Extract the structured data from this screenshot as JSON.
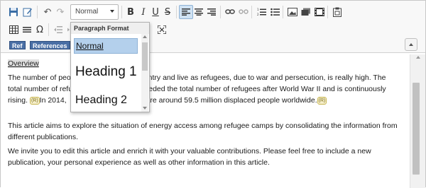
{
  "toolbar": {
    "format_select_value": "Normal",
    "icons": [
      "save-icon",
      "edit-icon",
      "undo-icon",
      "redo-icon",
      "bold-icon",
      "italic-icon",
      "underline-icon",
      "strikethrough-icon",
      "align-left-icon",
      "align-center-icon",
      "align-right-icon",
      "link-icon",
      "unlink-icon",
      "numbered-list-icon",
      "bulleted-list-icon",
      "image-icon",
      "gallery-icon",
      "video-icon",
      "paste-icon",
      "table-icon",
      "horizontal-rule-icon",
      "omega-icon",
      "indent-decrease-icon",
      "indent-increase-icon",
      "fullscreen-icon"
    ],
    "bold_glyph": "B",
    "italic_glyph": "I",
    "underline_glyph": "U",
    "strike_glyph": "S",
    "omega_glyph": "Ω",
    "ref_label": "Ref",
    "references_label": "References"
  },
  "dropdown": {
    "title": "Paragraph Format",
    "items": [
      {
        "label": "Normal",
        "selected": true
      },
      {
        "label": "Heading 1",
        "selected": false
      },
      {
        "label": "Heading 2",
        "selected": false
      }
    ]
  },
  "content": {
    "heading": "Overview",
    "p1_line1_start": "The number of peo",
    "p1_line1_end": "country and live as refugees, due to war and persecution, is really high. The",
    "p1_line2_start": "total number of refu",
    "p1_line2_end": "exceeded the total number of refugees after World War II and is continuously",
    "p1_line3_start": "rising.",
    "p1_line3_mid": "In 2014,",
    "p1_line3_end": "here are around 59.5 million displaced people worldwide.",
    "cite_label": "(R)",
    "p2": "This article aims to explore the situation of energy access among refugee camps by consolidating the information from different publications.",
    "p3": "We invite you to edit this article and enrich it with your valuable contributions. Please feel free to include a new publication, your personal experience as well as other information in this article."
  },
  "colors": {
    "accent": "#4a6fa5",
    "selected_bg": "#b4d0ec",
    "toolbar_bg": "#f8f8f8"
  }
}
